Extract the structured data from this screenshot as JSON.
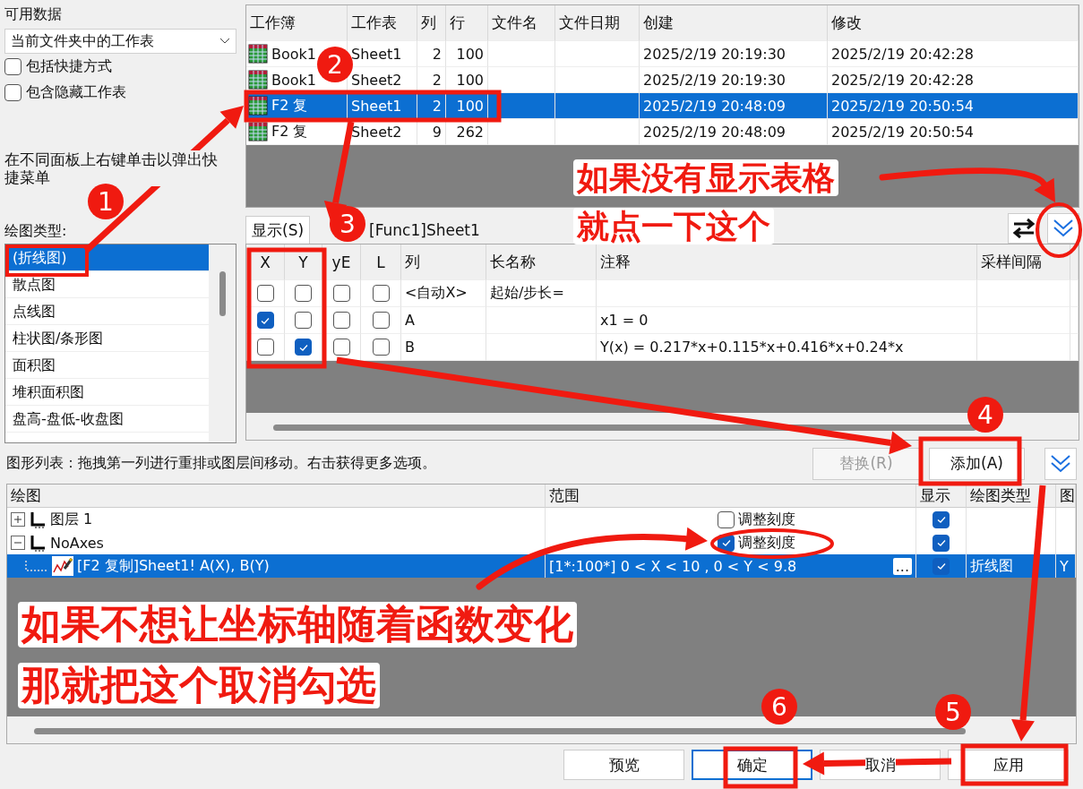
{
  "available_data": {
    "label": "可用数据",
    "dropdown": "当前文件夹中的工作表",
    "checkboxes": [
      {
        "label": "包括快捷方式",
        "checked": false
      },
      {
        "label": "包含隐藏工作表",
        "checked": false
      }
    ]
  },
  "hint": "在不同面板上右键单击以弹出快捷菜单",
  "plot_type": {
    "label": "绘图类型:",
    "items": [
      {
        "label": "(折线图)",
        "selected": true
      },
      {
        "label": "散点图",
        "selected": false
      },
      {
        "label": "点线图",
        "selected": false
      },
      {
        "label": "柱状图/条形图",
        "selected": false
      },
      {
        "label": "面积图",
        "selected": false
      },
      {
        "label": "堆积面积图",
        "selected": false
      },
      {
        "label": "盘高-盘低-收盘图",
        "selected": false
      }
    ]
  },
  "workbooks": {
    "columns": [
      "工作簿",
      "工作表",
      "列",
      "行",
      "文件名",
      "文件日期",
      "创建",
      "修改"
    ],
    "rows": [
      {
        "workbook": "Book1",
        "sheet": "Sheet1",
        "cols": "2",
        "rows": "100",
        "created": "2025/2/19 20:19:30",
        "modified": "2025/2/19 20:42:28",
        "selected": false
      },
      {
        "workbook": "Book1",
        "sheet": "Sheet2",
        "cols": "2",
        "rows": "100",
        "created": "2025/2/19 20:19:30",
        "modified": "2025/2/19 20:42:28",
        "selected": false
      },
      {
        "workbook": "F2  复",
        "sheet": "Sheet1",
        "cols": "2",
        "rows": "100",
        "created": "2025/2/19 20:48:09",
        "modified": "2025/2/19 20:50:54",
        "selected": true
      },
      {
        "workbook": "F2  复",
        "sheet": "Sheet2",
        "cols": "9",
        "rows": "262",
        "created": "2025/2/19 20:48:09",
        "modified": "2025/2/19 20:50:54",
        "selected": false
      }
    ]
  },
  "column_panel": {
    "tabs": [
      {
        "label": "显示(S)",
        "selected": true
      }
    ],
    "sheet": "[Func1]Sheet1",
    "columns": [
      "X",
      "Y",
      "yE",
      "L",
      "列",
      "长名称",
      "注释",
      "采样间隔"
    ],
    "rows": [
      {
        "x": false,
        "y": false,
        "yerr": false,
        "l": false,
        "column": "<自动X>",
        "long_name": "起始/步长="
      },
      {
        "x": true,
        "y": false,
        "yerr": false,
        "l": false,
        "column": "A",
        "comment": "x1 = 0"
      },
      {
        "x": false,
        "y": true,
        "yerr": false,
        "l": false,
        "column": "B",
        "comment": "Y(x) = 0.217*x+0.115*x+0.416*x+0.24*x"
      }
    ]
  },
  "plot_list": {
    "hint": "图形列表：拖拽第一列进行重排或图层间移动。右击获得更多选项。",
    "buttons": [
      {
        "label": "替换(R)",
        "disabled": true
      },
      {
        "label": "添加(A)",
        "disabled": false
      }
    ],
    "columns": [
      "绘图",
      "范围",
      "显示",
      "绘图类型",
      "图"
    ],
    "rows": [
      {
        "kind": "layer",
        "expanded": false,
        "label": "图层 1",
        "rescale": {
          "label": "调整刻度",
          "checked": false
        },
        "show": true,
        "selected": false
      },
      {
        "kind": "layer",
        "expanded": true,
        "label": "NoAxes",
        "rescale": {
          "label": "调整刻度",
          "checked": true
        },
        "show": true,
        "selected": false
      },
      {
        "kind": "plot",
        "label": "[F2  复制]Sheet1! A(X), B(Y)",
        "range": "[1*:100*]  0 < X < 10 , 0 < Y < 9.8",
        "ellipsis": "...",
        "show": true,
        "plot_type": "折线图",
        "extra": "Y",
        "selected": true
      }
    ]
  },
  "footer_buttons": [
    {
      "label": "预览",
      "default": false
    },
    {
      "label": "确定",
      "default": true
    },
    {
      "label": "取消",
      "default": false
    },
    {
      "label": "应用",
      "default": false
    }
  ],
  "annotations": {
    "notes": [
      "如果没有显示表格",
      "就点一下这个",
      "如果不想让坐标轴随着函数变化",
      "那就把这个取消勾选"
    ],
    "badges": [
      "1",
      "2",
      "3",
      "4",
      "5",
      "6"
    ]
  }
}
